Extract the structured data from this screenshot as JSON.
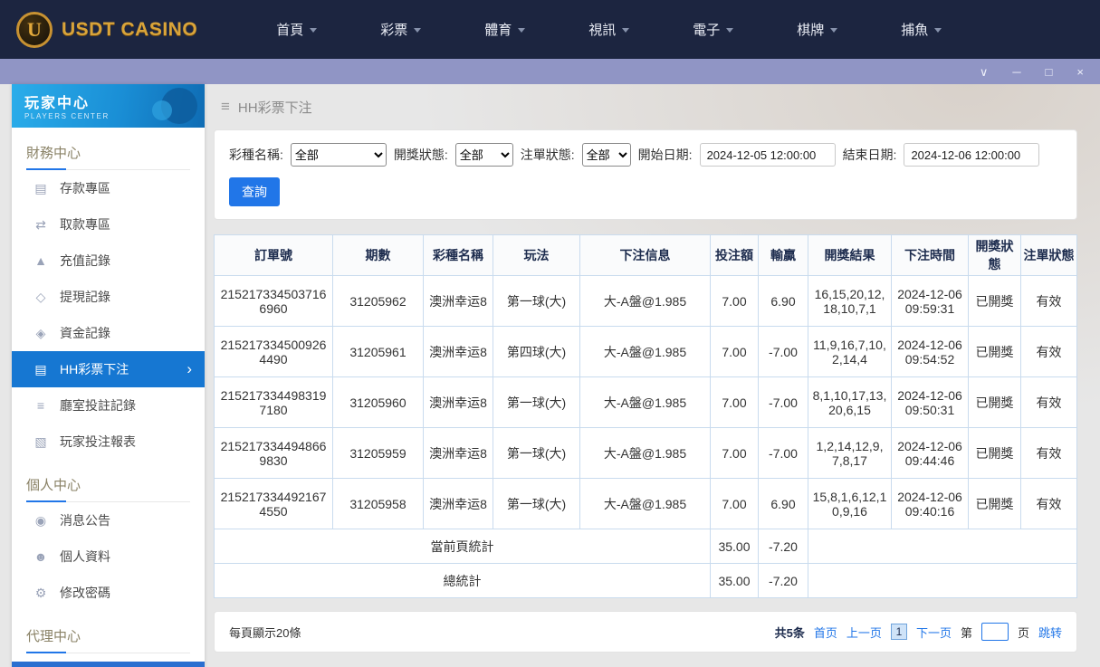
{
  "topnav": {
    "logo_text": "USDT CASINO",
    "logo_letter": "U",
    "items": [
      {
        "label": "首頁"
      },
      {
        "label": "彩票"
      },
      {
        "label": "體育"
      },
      {
        "label": "視訊"
      },
      {
        "label": "電子"
      },
      {
        "label": "棋牌"
      },
      {
        "label": "捕魚"
      }
    ]
  },
  "titlebar": {
    "collapse": "∨",
    "minimize": "─",
    "maximize": "□",
    "close": "×"
  },
  "sidebar": {
    "title": "玩家中心",
    "subtitle": "PLAYERS CENTER",
    "sections": [
      {
        "title": "財務中心",
        "items": [
          {
            "id": "deposit",
            "label": "存款專區",
            "icon": "deposit-card-icon",
            "glyph": "▤",
            "active": false
          },
          {
            "id": "withdraw",
            "label": "取款專區",
            "icon": "withdraw-transfer-icon",
            "glyph": "⇄",
            "active": false
          },
          {
            "id": "recharge-record",
            "label": "充值記錄",
            "icon": "recharge-record-icon",
            "glyph": "▲",
            "active": false
          },
          {
            "id": "withdrawal-record",
            "label": "提現記錄",
            "icon": "withdrawal-record-icon",
            "glyph": "◇",
            "active": false
          },
          {
            "id": "funds-record",
            "label": "資金記錄",
            "icon": "funds-record-icon",
            "glyph": "◈",
            "active": false
          },
          {
            "id": "hh-lottery-bet",
            "label": "HH彩票下注",
            "icon": "lottery-bet-icon",
            "glyph": "▤",
            "active": true
          },
          {
            "id": "hall-bet-record",
            "label": "廳室投註記錄",
            "icon": "hall-bet-record-icon",
            "glyph": "≡",
            "active": false
          },
          {
            "id": "player-bet-report",
            "label": "玩家投注報表",
            "icon": "player-bet-report-icon",
            "glyph": "▧",
            "active": false
          }
        ]
      },
      {
        "title": "個人中心",
        "items": [
          {
            "id": "announcements",
            "label": "消息公告",
            "icon": "announcement-bell-icon",
            "glyph": "◉",
            "active": false
          },
          {
            "id": "profile",
            "label": "個人資料",
            "icon": "profile-person-icon",
            "glyph": "☻",
            "active": false
          },
          {
            "id": "change-password",
            "label": "修改密碼",
            "icon": "change-password-gear-icon",
            "glyph": "⚙",
            "active": false
          }
        ]
      },
      {
        "title": "代理中心",
        "items": []
      }
    ]
  },
  "breadcrumb": {
    "menu_glyph": "≡",
    "title": "HH彩票下注"
  },
  "filters": {
    "lottery_name_label": "彩種名稱:",
    "lottery_name_value": "全部",
    "draw_status_label": "開獎狀態:",
    "draw_status_value": "全部",
    "order_status_label": "注單狀態:",
    "order_status_value": "全部",
    "start_date_label": "開始日期:",
    "start_date_value": "2024-12-05 12:00:00",
    "end_date_label": "結束日期:",
    "end_date_value": "2024-12-06 12:00:00",
    "query_button": "查詢"
  },
  "table": {
    "columns": [
      "訂單號",
      "期數",
      "彩種名稱",
      "玩法",
      "下注信息",
      "投注額",
      "輸贏",
      "開獎結果",
      "下注時間",
      "開獎狀態",
      "注單狀態"
    ],
    "rows": [
      [
        "2152173345037166960",
        "31205962",
        "澳洲幸运8",
        "第一球(大)",
        "大-A盤@1.985",
        "7.00",
        "6.90",
        "16,15,20,12,18,10,7,1",
        "2024-12-06 09:59:31",
        "已開獎",
        "有效"
      ],
      [
        "2152173345009264490",
        "31205961",
        "澳洲幸运8",
        "第四球(大)",
        "大-A盤@1.985",
        "7.00",
        "-7.00",
        "11,9,16,7,10,2,14,4",
        "2024-12-06 09:54:52",
        "已開獎",
        "有效"
      ],
      [
        "2152173344983197180",
        "31205960",
        "澳洲幸运8",
        "第一球(大)",
        "大-A盤@1.985",
        "7.00",
        "-7.00",
        "8,1,10,17,13,20,6,15",
        "2024-12-06 09:50:31",
        "已開獎",
        "有效"
      ],
      [
        "2152173344948669830",
        "31205959",
        "澳洲幸运8",
        "第一球(大)",
        "大-A盤@1.985",
        "7.00",
        "-7.00",
        "1,2,14,12,9,7,8,17",
        "2024-12-06 09:44:46",
        "已開獎",
        "有效"
      ],
      [
        "2152173344921674550",
        "31205958",
        "澳洲幸运8",
        "第一球(大)",
        "大-A盤@1.985",
        "7.00",
        "6.90",
        "15,8,1,6,12,10,9,16",
        "2024-12-06 09:40:16",
        "已開獎",
        "有效"
      ]
    ],
    "summary": [
      {
        "label": "當前頁統計",
        "bet_total": "35.00",
        "winloss_total": "-7.20"
      },
      {
        "label": "總統計",
        "bet_total": "35.00",
        "winloss_total": "-7.20"
      }
    ]
  },
  "pagination": {
    "page_size_text": "每頁顯示20條",
    "total_text": "共5条",
    "first": "首页",
    "prev": "上一页",
    "current_page": "1",
    "next": "下一页",
    "jump_prefix": "第",
    "jump_suffix": "页",
    "jump_action": "跳转"
  },
  "colors": {
    "topnav_bg": "#1c2540",
    "titlebar_bg": "#9095c5",
    "gold": "#d9a43a",
    "accent_blue": "#2176e8",
    "sidebar_active": "#1677d2",
    "table_border": "#c9dbee"
  }
}
